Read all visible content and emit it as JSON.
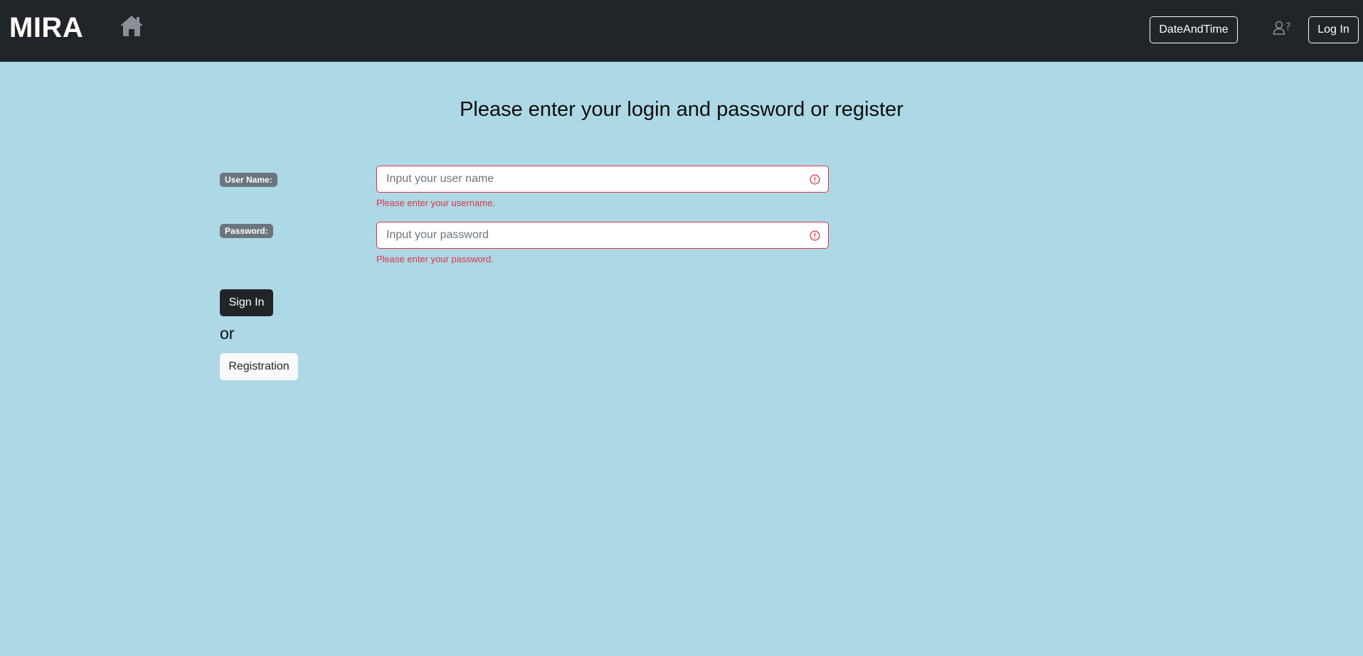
{
  "navbar": {
    "brand": "MIRA",
    "home_icon": "home-icon",
    "datetime_label": "DateAndTime",
    "user_help_icon": "user-question-icon",
    "login_label": "Log In"
  },
  "main": {
    "title": "Please enter your login and password or register",
    "username": {
      "label": "User Name:",
      "placeholder": "Input your user name",
      "value": "",
      "error": "Please enter your username."
    },
    "password": {
      "label": "Password:",
      "placeholder": "Input your password",
      "value": "",
      "error": "Please enter your password."
    },
    "signin_label": "Sign In",
    "or_text": "or",
    "register_label": "Registration"
  },
  "colors": {
    "page_background": "#add8e6",
    "navbar_background": "#212529",
    "error": "#dc3545",
    "badge": "#6c757d"
  }
}
